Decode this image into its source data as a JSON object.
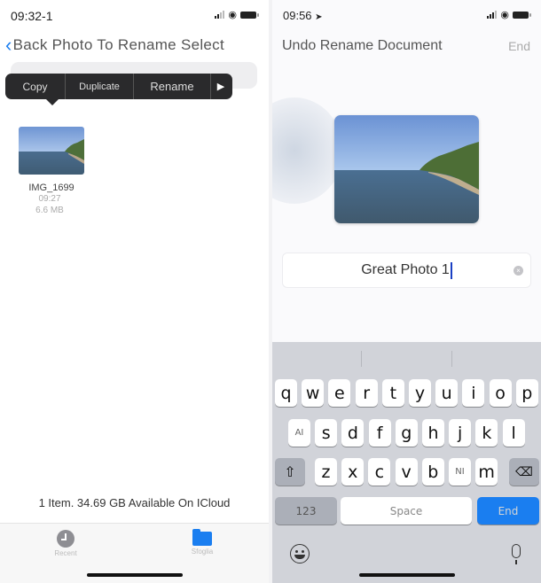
{
  "left": {
    "status": {
      "time": "09:32-1"
    },
    "nav": {
      "back_label": "Back Photo To Rename Select"
    },
    "search": {
      "placeholder": ""
    },
    "context_menu": {
      "items": [
        "Copy",
        "Duplicate",
        "Rename"
      ],
      "more_icon": "play-right-arrow"
    },
    "file": {
      "name": "IMG_1699",
      "time": "09:27",
      "size": "6.6 MB"
    },
    "footer_info": "1 Item. 34.69 GB Available On ICloud",
    "tabs": [
      {
        "label": "Recent",
        "icon": "clock-icon"
      },
      {
        "label": "Sfoglia",
        "icon": "folder-icon"
      }
    ]
  },
  "right": {
    "status": {
      "time": "09:56"
    },
    "header": {
      "title": "Undo Rename Document",
      "done_label": "End"
    },
    "name_field": {
      "value": "Great Photo 1"
    },
    "keyboard": {
      "row1": [
        "q",
        "w",
        "e",
        "r",
        "t",
        "y",
        "u",
        "i",
        "o",
        "p"
      ],
      "row2": [
        "AI",
        "s",
        "d",
        "f",
        "g",
        "h",
        "j",
        "k",
        "l"
      ],
      "row3": [
        "z",
        "x",
        "c",
        "v",
        "b",
        "NI",
        "m"
      ],
      "shift_icon": "shift-icon",
      "delete_icon": "delete-icon",
      "numbers_label": "123",
      "space_label": "Space",
      "return_label": "End"
    }
  },
  "colors": {
    "accent": "#1a7ef0",
    "keyboard_bg": "#d1d3d9",
    "menu_bg": "#2a2a2c"
  }
}
